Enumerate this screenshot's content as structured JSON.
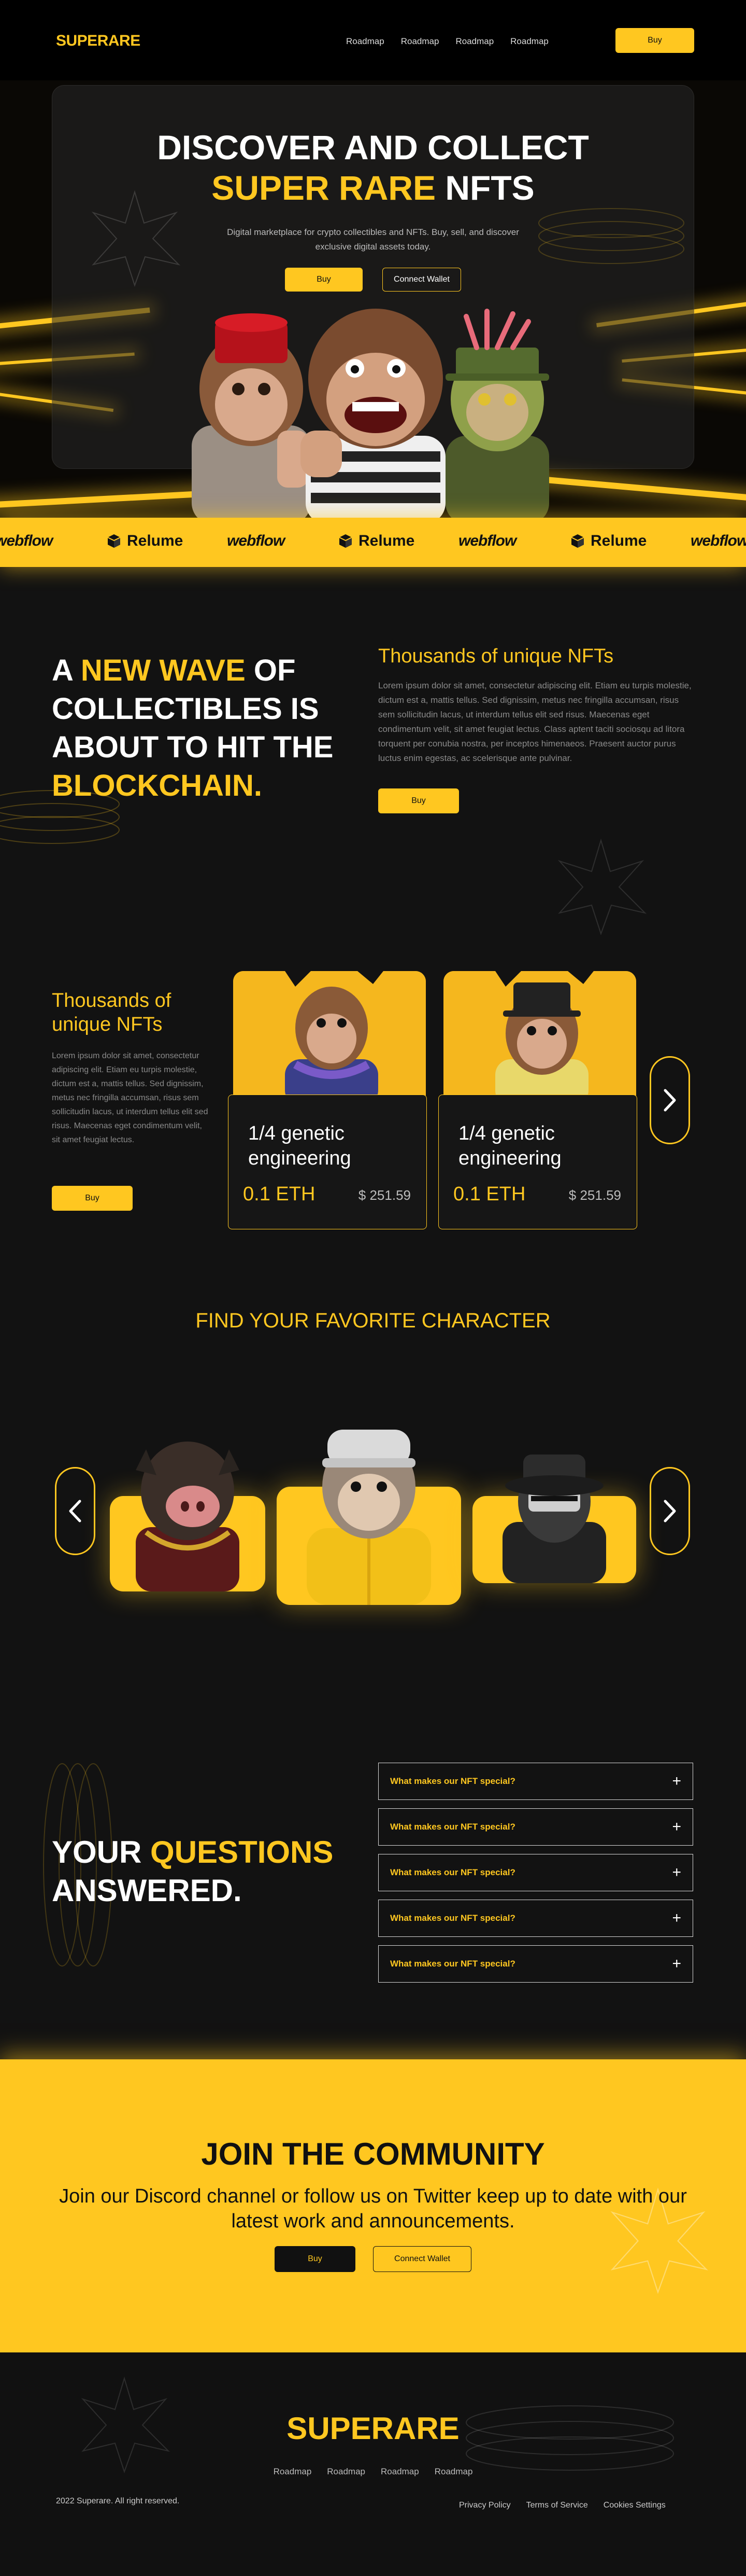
{
  "nav": {
    "logo": "SUPERARE",
    "links": [
      "Roadmap",
      "Roadmap",
      "Roadmap",
      "Roadmap"
    ],
    "buy_label": "Buy"
  },
  "hero": {
    "title_line1": "DISCOVER AND COLLECT",
    "title_yellow": "SUPER RARE",
    "title_rest": " NFTS",
    "description": "Digital marketplace for crypto collectibles and NFTs. Buy, sell, and discover exclusive digital assets today.",
    "buy_label": "Buy",
    "connect_label": "Connect Wallet"
  },
  "ticker": {
    "items": [
      "webflow",
      "Relume",
      "webflow",
      "Relume",
      "webflow",
      "Relume",
      "webflow"
    ]
  },
  "wave": {
    "line1_white": "A ",
    "line1_yellow": "NEW WAVE",
    "line1_rest": " OF",
    "line2": "COLLECTIBLES IS",
    "line3": "ABOUT TO HIT THE",
    "line4_yellow": "BLOCKCHAIN.",
    "subheading": "Thousands of unique NFTs",
    "body": "Lorem ipsum dolor sit amet, consectetur adipiscing elit. Etiam eu turpis molestie, dictum est a, mattis tellus. Sed dignissim, metus nec fringilla accumsan, risus sem sollicitudin lacus, ut interdum tellus elit sed risus. Maecenas eget condimentum velit, sit amet feugiat lectus. Class aptent taciti sociosqu ad litora torquent per conubia nostra, per inceptos himenaeos. Praesent auctor purus luctus enim egestas, ac scelerisque ante pulvinar.",
    "buy_label": "Buy"
  },
  "collection": {
    "heading": "Thousands of unique NFTs",
    "body": "Lorem ipsum dolor sit amet, consectetur adipiscing elit. Etiam eu turpis molestie, dictum est a, mattis tellus. Sed dignissim, metus nec fringilla accumsan, risus sem sollicitudin lacus, ut interdum tellus elit sed risus. Maecenas eget condimentum velit, sit amet feugiat lectus.",
    "buy_label": "Buy",
    "cards": [
      {
        "title": "1/4 genetic engineering",
        "eth": "0.1 ETH",
        "usd": "$ 251.59"
      },
      {
        "title": "1/4 genetic engineering",
        "eth": "0.1 ETH",
        "usd": "$ 251.59"
      }
    ]
  },
  "characters": {
    "heading": "FIND YOUR FAVORITE CHARACTER"
  },
  "faq": {
    "heading_white1": "YOUR ",
    "heading_yellow": "QUESTIONS",
    "heading_line2": "ANSWERED.",
    "items": [
      "What makes our NFT special?",
      "What makes our NFT special?",
      "What makes our NFT special?",
      "What makes our NFT special?",
      "What makes our NFT special?"
    ]
  },
  "join": {
    "heading": "JOIN THE COMMUNITY",
    "body": "Join our Discord channel or follow us on Twitter keep up to date with our latest work and announcements.",
    "buy_label": "Buy",
    "connect_label": "Connect Wallet"
  },
  "footer": {
    "logo": "SUPERARE",
    "links": [
      "Roadmap",
      "Roadmap",
      "Roadmap",
      "Roadmap"
    ],
    "copyright": "2022 Superare. All right reserved.",
    "legal": [
      "Privacy Policy",
      "Terms of Service",
      "Cookies Settings"
    ]
  },
  "colors": {
    "accent": "#FFC720",
    "background": "#121212",
    "dark": "#000000"
  }
}
